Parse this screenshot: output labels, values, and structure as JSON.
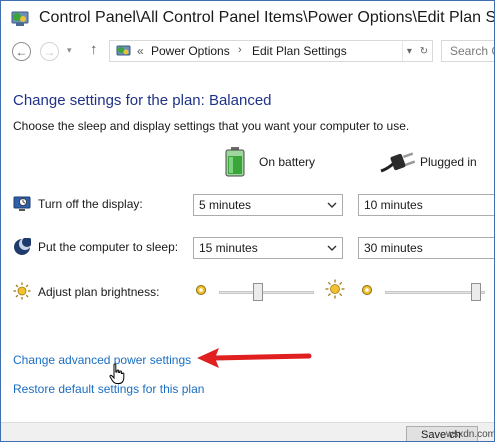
{
  "window": {
    "title": "Control Panel\\All Control Panel Items\\Power Options\\Edit Plan Settings"
  },
  "nav": {
    "back_glyph": "←",
    "forward_glyph": "→",
    "recent_glyph": "▾",
    "up_glyph": "↑"
  },
  "address": {
    "prefix": "«",
    "crumb1": "Power Options",
    "separator": "›",
    "crumb2": "Edit Plan Settings",
    "dropdown_glyph": "▾",
    "refresh_glyph": "↻"
  },
  "search": {
    "placeholder": "Search Co"
  },
  "content": {
    "heading": "Change settings for the plan: Balanced",
    "description": "Choose the sleep and display settings that you want your computer to use."
  },
  "columns": {
    "battery": "On battery",
    "plugged": "Plugged in"
  },
  "settings": {
    "display": {
      "label": "Turn off the display:",
      "battery": "5 minutes",
      "plugged": "10 minutes"
    },
    "sleep": {
      "label": "Put the computer to sleep:",
      "battery": "15 minutes",
      "plugged": "30 minutes"
    },
    "brightness": {
      "label": "Adjust plan brightness:",
      "battery_level": 0.4,
      "plugged_level": 0.95
    }
  },
  "links": {
    "advanced": "Change advanced power settings",
    "restore": "Restore default settings for this plan"
  },
  "footer": {
    "save_button": "Save ch",
    "watermark": "wsxdn.com"
  },
  "icons": {
    "app": "control-panel-icon",
    "battery": "battery-icon",
    "plug": "plug-icon",
    "display": "monitor-icon",
    "sleep": "moon-icon",
    "brightness_low": "sun-dim-icon",
    "brightness_high": "sun-bright-icon",
    "annotation": "red-arrow-icon",
    "cursor": "hand-cursor-icon"
  },
  "colors": {
    "heading": "#1e3287",
    "link": "#1a6ec2",
    "annotation": "#e02020",
    "battery": "#3aa63a"
  }
}
